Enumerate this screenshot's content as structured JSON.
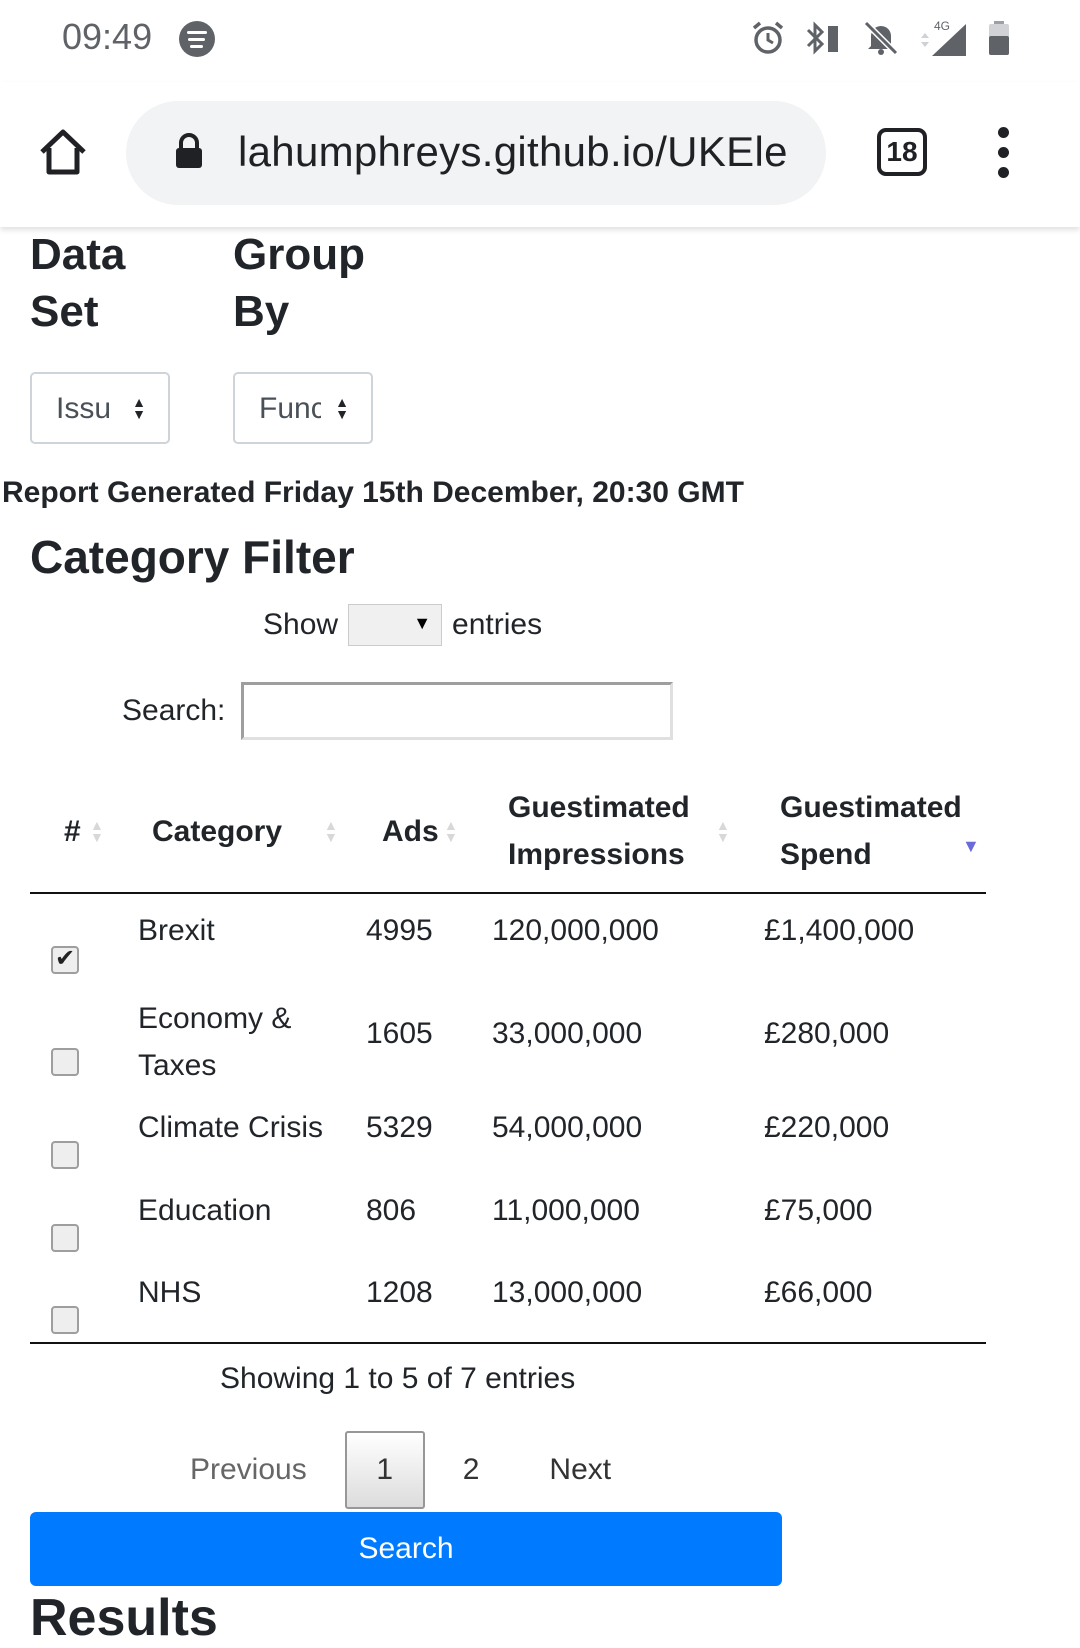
{
  "status_bar": {
    "time": "09:49",
    "network": "4G"
  },
  "browser": {
    "url": "lahumphreys.github.io/UKEle",
    "tab_count": "18"
  },
  "controls": {
    "data_set_label": "Data Set",
    "data_set_value": "Issu",
    "group_by_label": "Group By",
    "group_by_value": "Func"
  },
  "report_generated": "Report Generated Friday 15th December, 20:30 GMT",
  "category_filter": {
    "title": "Category Filter",
    "show_label": "Show",
    "entries_label": "entries",
    "search_label": "Search:",
    "search_value": "",
    "columns": [
      "#",
      "Category",
      "Ads",
      "Guestimated Impressions",
      "Guestimated Spend"
    ],
    "sort_column": "Guestimated Spend",
    "rows": [
      {
        "checked": true,
        "category": "Brexit",
        "ads": "4995",
        "impressions": "120,000,000",
        "spend": "£1,400,000"
      },
      {
        "checked": false,
        "category": "Economy & Taxes",
        "ads": "1605",
        "impressions": "33,000,000",
        "spend": "£280,000"
      },
      {
        "checked": false,
        "category": "Climate Crisis",
        "ads": "5329",
        "impressions": "54,000,000",
        "spend": "£220,000"
      },
      {
        "checked": false,
        "category": "Education",
        "ads": "806",
        "impressions": "11,000,000",
        "spend": "£75,000"
      },
      {
        "checked": false,
        "category": "NHS",
        "ads": "1208",
        "impressions": "13,000,000",
        "spend": "£66,000"
      }
    ],
    "info": "Showing 1 to 5 of 7 entries",
    "pagination": {
      "previous": "Previous",
      "current": "1",
      "page2": "2",
      "next": "Next"
    }
  },
  "search_button": "Search",
  "results_heading": "Results",
  "icons": [
    "spotify-icon",
    "alarm-icon",
    "bluetooth-icon",
    "muted-bell-icon",
    "signal-icon",
    "battery-icon",
    "home-icon",
    "lock-icon",
    "tabs-icon",
    "overflow-menu-icon",
    "sort-icon",
    "checkbox-icon"
  ]
}
